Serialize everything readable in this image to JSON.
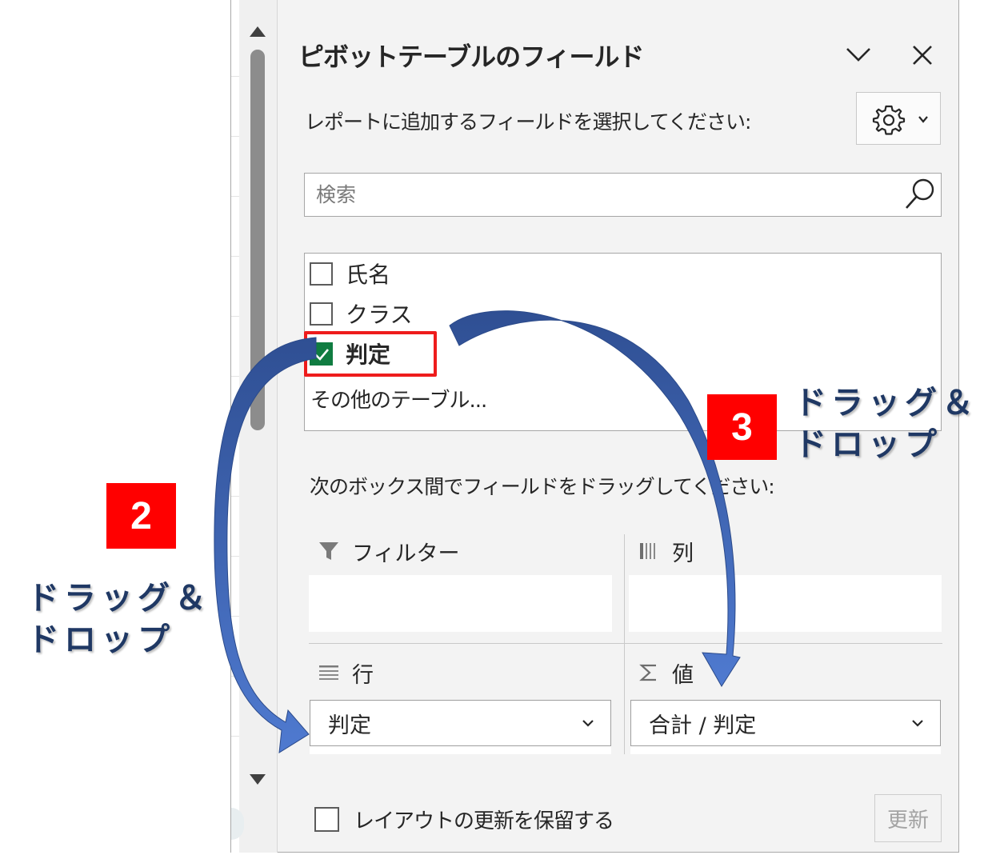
{
  "pane": {
    "title": "ピボットテーブルのフィールド",
    "choose_fields_label": "レポートに追加するフィールドを選択してください:",
    "search": {
      "placeholder": "検索",
      "value": ""
    },
    "fields": [
      {
        "label": "氏名",
        "checked": false
      },
      {
        "label": "クラス",
        "checked": false
      },
      {
        "label": "判定",
        "checked": true
      }
    ],
    "more_tables_link": "その他のテーブル...",
    "drag_label": "次のボックス間でフィールドをドラッグしてください:",
    "areas": {
      "filters": {
        "label": "フィルター",
        "items": []
      },
      "columns": {
        "label": "列",
        "items": []
      },
      "rows": {
        "label": "行",
        "items": [
          "判定"
        ]
      },
      "values": {
        "label": "値",
        "items": [
          "合計 / 判定"
        ]
      }
    },
    "defer_update": {
      "label": "レイアウトの更新を保留する",
      "checked": false
    },
    "update_button": "更新"
  },
  "annotations": {
    "step2": {
      "number": "2",
      "text_line1": "ドラッグ＆",
      "text_line2": "ドロップ"
    },
    "step3": {
      "number": "3",
      "text_line1": "ドラッグ＆",
      "text_line2": "ドロップ"
    },
    "highlight_color": "#ee1c1c",
    "badge_color": "#ff0000",
    "arrow_color": "#3f66b5"
  },
  "colors": {
    "pane_background": "#f3f3f3",
    "checkbox_checked": "#107c41",
    "text": "#262626"
  }
}
